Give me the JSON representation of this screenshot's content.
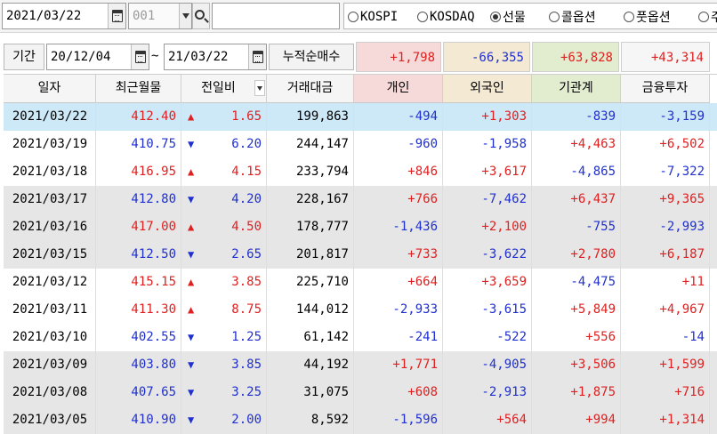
{
  "toolbar": {
    "date": "2021/03/22",
    "code_placeholder": "001",
    "name_value": "",
    "markets": [
      {
        "label": "KOSPI",
        "checked": false
      },
      {
        "label": "KOSDAQ",
        "checked": false
      },
      {
        "label": "선물",
        "checked": true
      },
      {
        "label": "콜옵션",
        "checked": false
      },
      {
        "label": "풋옵션",
        "checked": false
      },
      {
        "label": "주",
        "checked": false
      }
    ]
  },
  "period": {
    "label": "기간",
    "from": "20/12/04",
    "separator": "~",
    "to": "21/03/22",
    "net_label": "누적순매수",
    "sums": [
      "+1,798",
      "-66,355",
      "+63,828",
      "+43,314"
    ]
  },
  "colors": {
    "up": "#e02020",
    "down": "#2030d0",
    "selected_row": "#cde8f6",
    "shaded_row": "#e6e6e6",
    "individual_header": "#f6d9d9",
    "foreign_header": "#f4e9d2",
    "institution_header": "#e2edd0",
    "sum_individual": "#f6d9d9",
    "sum_foreign": "#f4e9d2",
    "sum_institution": "#e2edd0",
    "sum_finance": "#f6f6f6"
  },
  "table": {
    "columns": [
      "일자",
      "최근월물",
      "전일비",
      "거래대금",
      "개인",
      "외국인",
      "기관계",
      "금융투자"
    ],
    "rows": [
      {
        "date": "2021/03/22",
        "price": "412.40",
        "dir": "up",
        "change": "1.65",
        "volume": "199,863",
        "indiv": "-494",
        "foreign": "+1,303",
        "inst": "-839",
        "finance": "-3,159",
        "style": "selected"
      },
      {
        "date": "2021/03/19",
        "price": "410.75",
        "dir": "down",
        "change": "6.20",
        "volume": "244,147",
        "indiv": "-960",
        "foreign": "-1,958",
        "inst": "+4,463",
        "finance": "+6,502",
        "style": "white"
      },
      {
        "date": "2021/03/18",
        "price": "416.95",
        "dir": "up",
        "change": "4.15",
        "volume": "233,794",
        "indiv": "+846",
        "foreign": "+3,617",
        "inst": "-4,865",
        "finance": "-7,322",
        "style": "white"
      },
      {
        "date": "2021/03/17",
        "price": "412.80",
        "dir": "down",
        "change": "4.20",
        "volume": "228,167",
        "indiv": "+766",
        "foreign": "-7,462",
        "inst": "+6,437",
        "finance": "+9,365",
        "style": "shaded"
      },
      {
        "date": "2021/03/16",
        "price": "417.00",
        "dir": "up",
        "change": "4.50",
        "volume": "178,777",
        "indiv": "-1,436",
        "foreign": "+2,100",
        "inst": "-755",
        "finance": "-2,993",
        "style": "shaded"
      },
      {
        "date": "2021/03/15",
        "price": "412.50",
        "dir": "down",
        "change": "2.65",
        "volume": "201,817",
        "indiv": "+733",
        "foreign": "-3,622",
        "inst": "+2,780",
        "finance": "+6,187",
        "style": "shaded"
      },
      {
        "date": "2021/03/12",
        "price": "415.15",
        "dir": "up",
        "change": "3.85",
        "volume": "225,710",
        "indiv": "+664",
        "foreign": "+3,659",
        "inst": "-4,475",
        "finance": "+11",
        "style": "white"
      },
      {
        "date": "2021/03/11",
        "price": "411.30",
        "dir": "up",
        "change": "8.75",
        "volume": "144,012",
        "indiv": "-2,933",
        "foreign": "-3,615",
        "inst": "+5,849",
        "finance": "+4,967",
        "style": "white"
      },
      {
        "date": "2021/03/10",
        "price": "402.55",
        "dir": "down",
        "change": "1.25",
        "volume": "61,142",
        "indiv": "-241",
        "foreign": "-522",
        "inst": "+556",
        "finance": "-14",
        "style": "white"
      },
      {
        "date": "2021/03/09",
        "price": "403.80",
        "dir": "down",
        "change": "3.85",
        "volume": "44,192",
        "indiv": "+1,771",
        "foreign": "-4,905",
        "inst": "+3,506",
        "finance": "+1,599",
        "style": "shaded"
      },
      {
        "date": "2021/03/08",
        "price": "407.65",
        "dir": "down",
        "change": "3.25",
        "volume": "31,075",
        "indiv": "+608",
        "foreign": "-2,913",
        "inst": "+1,875",
        "finance": "+716",
        "style": "shaded"
      },
      {
        "date": "2021/03/05",
        "price": "410.90",
        "dir": "down",
        "change": "2.00",
        "volume": "8,592",
        "indiv": "-1,596",
        "foreign": "+564",
        "inst": "+994",
        "finance": "+1,314",
        "style": "shaded"
      }
    ]
  }
}
